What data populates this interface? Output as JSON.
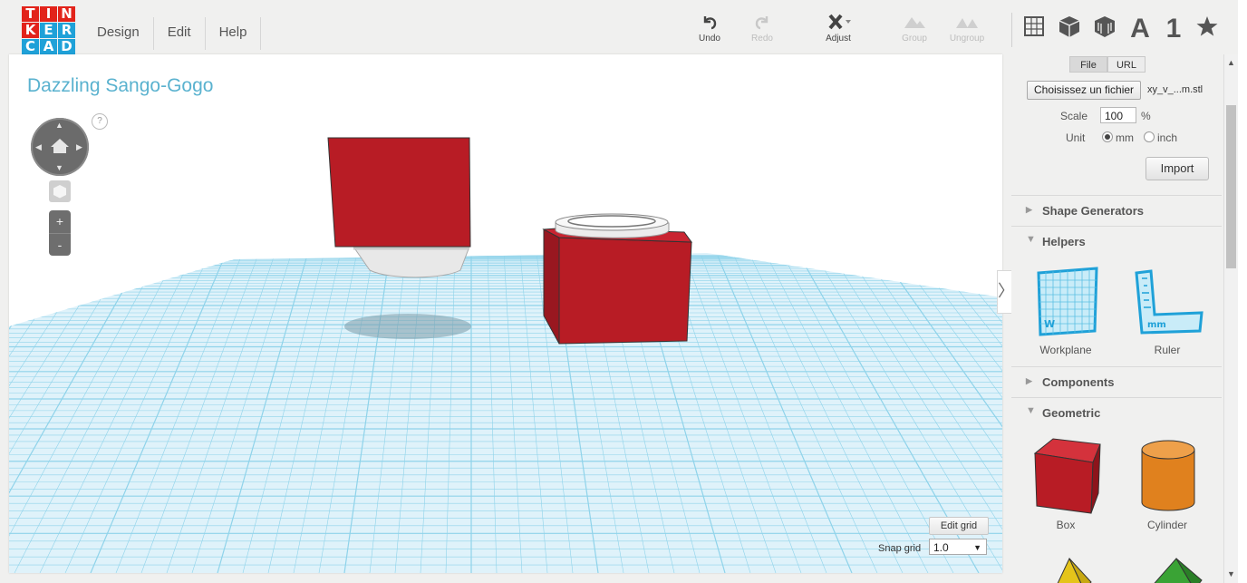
{
  "logo": {
    "rows": [
      [
        "T",
        "I",
        "N"
      ],
      [
        "K",
        "E",
        "R"
      ],
      [
        "C",
        "A",
        "D"
      ]
    ]
  },
  "menu": [
    "Design",
    "Edit",
    "Help"
  ],
  "toolbar": {
    "undo": "Undo",
    "redo": "Redo",
    "adjust": "Adjust",
    "group": "Group",
    "ungroup": "Ungroup",
    "text_icon": "A",
    "number_icon": "1"
  },
  "design": {
    "title": "Dazzling Sango-Gogo",
    "help": "?"
  },
  "zoom": {
    "plus": "+",
    "minus": "-"
  },
  "grid": {
    "edit_label": "Edit grid",
    "snap_label": "Snap grid",
    "snap_value": "1.0"
  },
  "collapse_glyph": "〉",
  "import": {
    "tabs": [
      "File",
      "URL"
    ],
    "choose_file": "Choisissez un fichier",
    "file_name": "xy_v_...m.stl",
    "scale_label": "Scale",
    "scale_value": "100",
    "scale_unit": "%",
    "unit_label": "Unit",
    "unit_mm": "mm",
    "unit_inch": "inch",
    "button": "Import"
  },
  "sections": {
    "shape_generators": "Shape Generators",
    "helpers": "Helpers",
    "components": "Components",
    "geometric": "Geometric"
  },
  "helpers": [
    "Workplane",
    "Ruler"
  ],
  "geometric": [
    "Box",
    "Cylinder"
  ],
  "colors": {
    "logo_red": "#e2231a",
    "logo_blue": "#1fa1d8",
    "title": "#5ab2cf",
    "grid": "#8fd3ea",
    "box_red": "#b81c25",
    "cylinder": "#e0811e"
  }
}
